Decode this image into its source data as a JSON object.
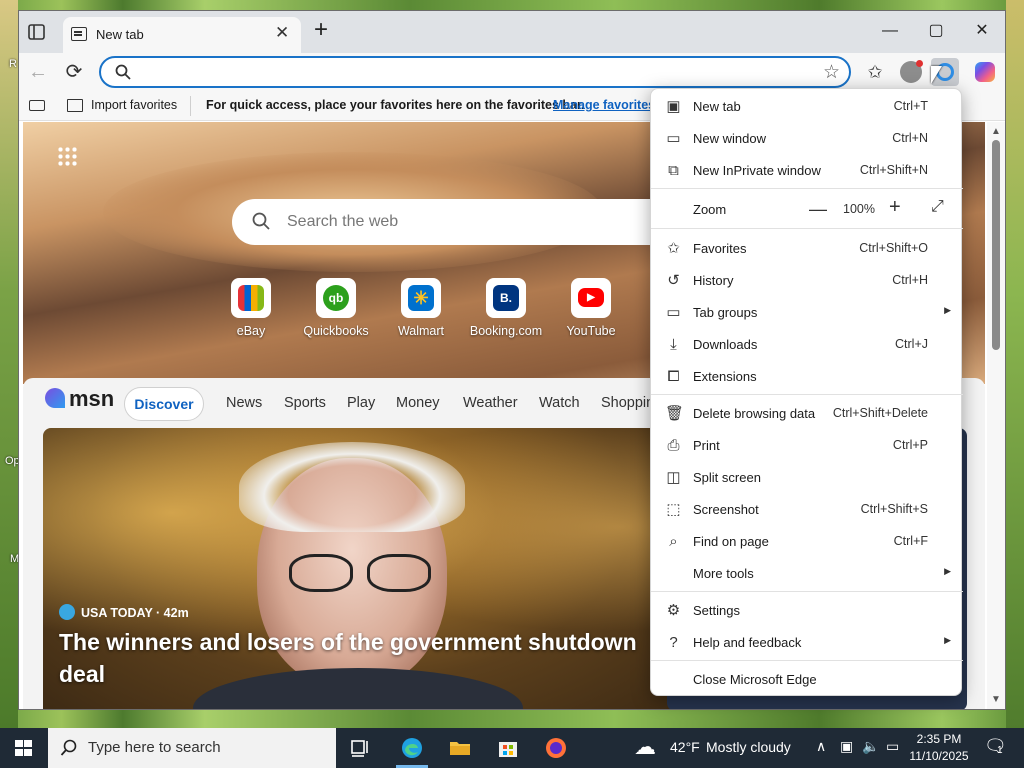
{
  "browser": {
    "tab_title": "New tab",
    "address_value": "",
    "favorites_bar": {
      "import_label": "Import favorites",
      "hint": "For quick access, place your favorites here on the favorites bar.",
      "manage_link": "Manage favorites"
    }
  },
  "desktop": {
    "left_letters": [
      "R",
      "Op",
      "M"
    ]
  },
  "newtab": {
    "search_placeholder": "Search the web",
    "quick_links": [
      {
        "label": "eBay",
        "color": "#ffffff"
      },
      {
        "label": "Quickbooks",
        "color": "#2ca01c"
      },
      {
        "label": "Walmart",
        "color": "#0071ce"
      },
      {
        "label": "Booking.com",
        "color": "#003580"
      },
      {
        "label": "YouTube",
        "color": "#ff0000"
      }
    ],
    "msn": {
      "logo": "msn",
      "nav": [
        "Discover",
        "News",
        "Sports",
        "Play",
        "Money",
        "Weather",
        "Watch",
        "Shoppin"
      ],
      "story": {
        "source": "USA TODAY · 42m",
        "headline": "The winners and losers of the government shutdown deal"
      }
    }
  },
  "menu": {
    "items": [
      {
        "icon": "new-tab-icon",
        "label": "New tab",
        "shortcut": "Ctrl+T"
      },
      {
        "icon": "new-window-icon",
        "label": "New window",
        "shortcut": "Ctrl+N"
      },
      {
        "icon": "inprivate-icon",
        "label": "New InPrivate window",
        "shortcut": "Ctrl+Shift+N"
      },
      {
        "label": "Zoom",
        "value": "100%"
      },
      {
        "icon": "favorites-icon",
        "label": "Favorites",
        "shortcut": "Ctrl+Shift+O"
      },
      {
        "icon": "history-icon",
        "label": "History",
        "shortcut": "Ctrl+H"
      },
      {
        "icon": "tab-groups-icon",
        "label": "Tab groups"
      },
      {
        "icon": "download-icon",
        "label": "Downloads",
        "shortcut": "Ctrl+J"
      },
      {
        "icon": "extensions-icon",
        "label": "Extensions"
      },
      {
        "icon": "trash-icon",
        "label": "Delete browsing data",
        "shortcut": "Ctrl+Shift+Delete"
      },
      {
        "icon": "print-icon",
        "label": "Print",
        "shortcut": "Ctrl+P"
      },
      {
        "icon": "split-screen-icon",
        "label": "Split screen"
      },
      {
        "icon": "screenshot-icon",
        "label": "Screenshot",
        "shortcut": "Ctrl+Shift+S"
      },
      {
        "icon": "find-icon",
        "label": "Find on page",
        "shortcut": "Ctrl+F"
      },
      {
        "label": "More tools"
      },
      {
        "icon": "settings-icon",
        "label": "Settings"
      },
      {
        "icon": "help-icon",
        "label": "Help and feedback"
      },
      {
        "label": "Close Microsoft Edge"
      }
    ]
  },
  "taskbar": {
    "search_placeholder": "Type here to search",
    "weather_temp": "42°F",
    "weather_desc": "Mostly cloudy",
    "time": "2:35 PM",
    "date": "11/10/2025",
    "notification_count": "1"
  },
  "colors": {
    "accent": "#0f62c1",
    "taskbar_bg": "#1f2a36"
  }
}
